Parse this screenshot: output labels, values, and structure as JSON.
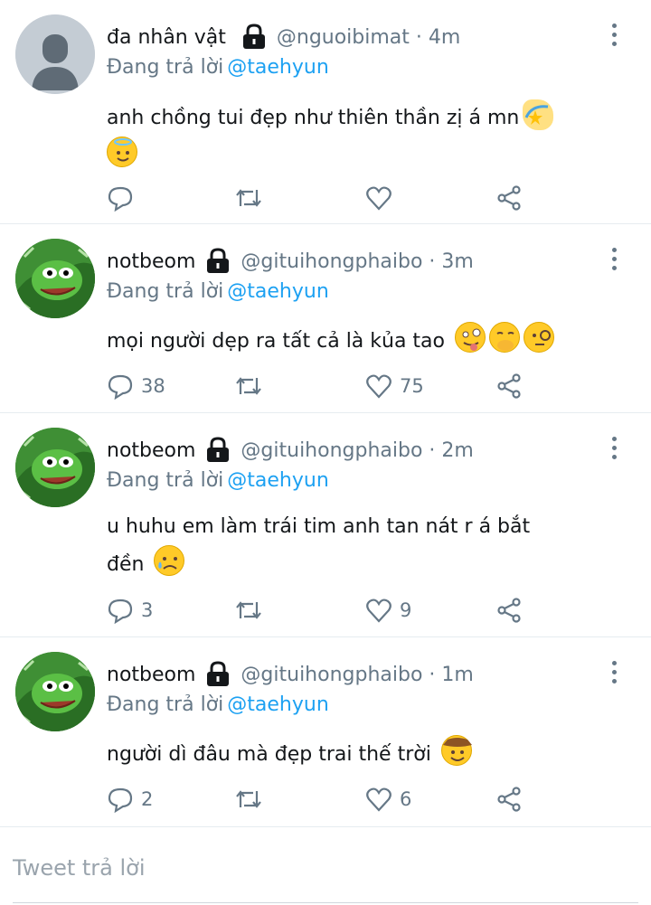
{
  "tweets": [
    {
      "name": "đa nhân vật",
      "handle": "@nguoibimat",
      "time": "4m",
      "meta": "@nguoibimat · 4m",
      "reply_prefix": "Đang trả lời",
      "reply_handle": "@taehyun",
      "text": "anh chồng tui đẹp như thiên thần zị á mn",
      "avatar": "default-avatar",
      "emojis": [
        "dizzy-star-emoji",
        "angel-emoji"
      ],
      "replies": "",
      "likes": ""
    },
    {
      "name": "notbeom",
      "handle": "@gituihongphaibo",
      "time": "3m",
      "meta": "@gituihongphaibo · 3m",
      "reply_prefix": "Đang trả lời",
      "reply_handle": "@taehyun",
      "text": "mọi người dẹp ra tất cả là kủa tao",
      "avatar": "pepe-avatar",
      "emojis": [
        "zany-face-emoji",
        "hand-over-mouth-emoji",
        "monocle-face-emoji"
      ],
      "replies": "38",
      "likes": "75"
    },
    {
      "name": "notbeom",
      "handle": "@gituihongphaibo",
      "time": "2m",
      "meta": "@gituihongphaibo · 2m",
      "reply_prefix": "Đang trả lời",
      "reply_handle": "@taehyun",
      "text_line1": "u huhu em làm trái tim anh tan nát r á bắt",
      "text_line2": "đền",
      "avatar": "pepe-avatar",
      "emojis": [
        "sad-sweat-face-emoji"
      ],
      "replies": "3",
      "likes": "9"
    },
    {
      "name": "notbeom",
      "handle": "@gituihongphaibo",
      "time": "1m",
      "meta": "@gituihongphaibo · 1m",
      "reply_prefix": "Đang trả lời",
      "reply_handle": "@taehyun",
      "text": "người dì đâu mà đẹp trai thế trời",
      "avatar": "pepe-avatar",
      "emojis": [
        "cowboy-face-emoji"
      ],
      "replies": "2",
      "likes": "6"
    }
  ],
  "composer": {
    "placeholder": "Tweet trả lời"
  },
  "colors": {
    "link": "#1da1f2",
    "muted": "#657786",
    "divider": "#e6ecf0"
  },
  "icons": [
    "lock-icon",
    "reply-icon",
    "retweet-icon",
    "like-icon",
    "share-icon",
    "more-icon"
  ]
}
